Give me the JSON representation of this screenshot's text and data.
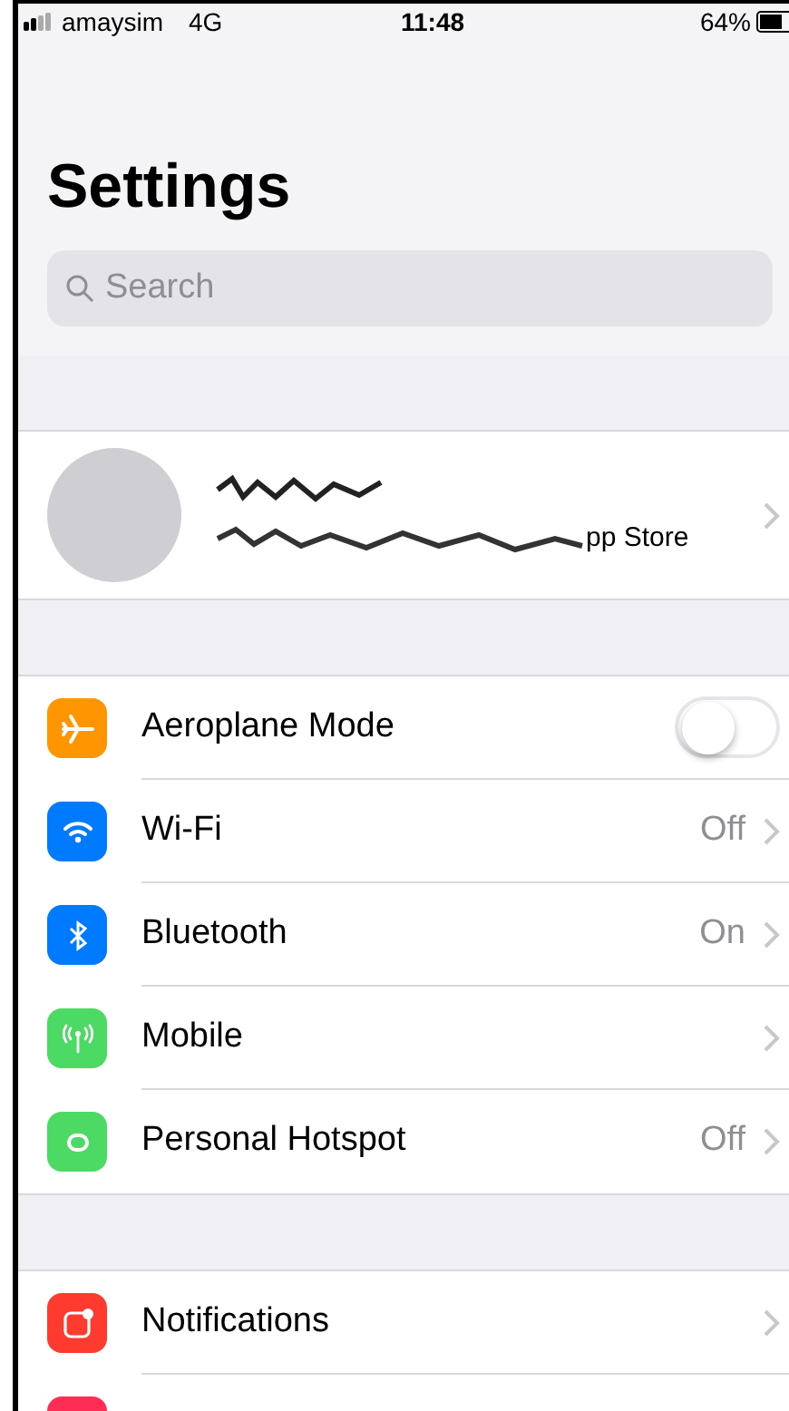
{
  "status_bar": {
    "carrier": "amaysim",
    "network": "4G",
    "time": "11:48",
    "battery": "64%"
  },
  "title": "Settings",
  "search": {
    "placeholder": "Search"
  },
  "profile": {
    "subtitle": "pp Store"
  },
  "groups": [
    {
      "rows": [
        {
          "kind": "toggle",
          "label": "Aeroplane Mode",
          "color": "#ff9500",
          "on": false
        },
        {
          "kind": "link",
          "label": "Wi-Fi",
          "color": "#007aff",
          "value": "Off"
        },
        {
          "kind": "link",
          "label": "Bluetooth",
          "color": "#007aff",
          "value": "On"
        },
        {
          "kind": "link",
          "label": "Mobile",
          "color": "#4cd964"
        },
        {
          "kind": "link",
          "label": "Personal Hotspot",
          "color": "#4cd964",
          "value": "Off"
        }
      ]
    },
    {
      "rows": [
        {
          "kind": "link",
          "label": "Notifications",
          "color": "#ff3b30"
        },
        {
          "kind": "partial",
          "color": "#ff2d55"
        }
      ]
    }
  ]
}
